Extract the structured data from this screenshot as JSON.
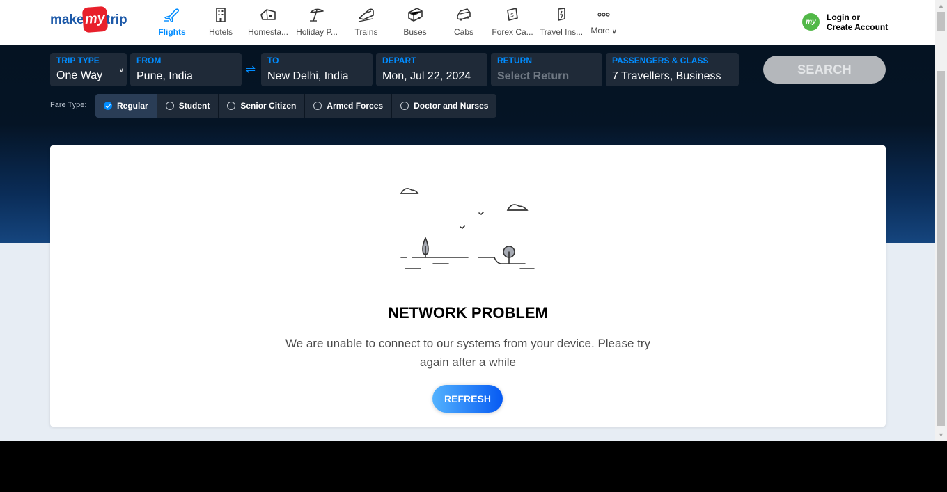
{
  "brand": {
    "make": "make",
    "my": "my",
    "trip": "trip"
  },
  "nav": [
    {
      "label": "Flights",
      "icon": "flight-icon",
      "active": true
    },
    {
      "label": "Hotels",
      "icon": "hotel-icon"
    },
    {
      "label": "Homesta...",
      "icon": "homestay-icon"
    },
    {
      "label": "Holiday P...",
      "icon": "holiday-package-icon"
    },
    {
      "label": "Trains",
      "icon": "train-icon"
    },
    {
      "label": "Buses",
      "icon": "bus-icon"
    },
    {
      "label": "Cabs",
      "icon": "cab-icon"
    },
    {
      "label": "Forex Ca...",
      "icon": "forex-card-icon"
    },
    {
      "label": "Travel Ins...",
      "icon": "travel-insurance-icon"
    },
    {
      "label": "More",
      "icon": "more-dots-icon"
    }
  ],
  "user": {
    "line1": "Login or",
    "line2": "Create Account",
    "avatar": "my"
  },
  "search": {
    "trip_type": {
      "label": "TRIP TYPE",
      "value": "One Way"
    },
    "from": {
      "label": "FROM",
      "value": "Pune, India"
    },
    "to": {
      "label": "TO",
      "value": "New Delhi, India"
    },
    "depart": {
      "label": "DEPART",
      "value": "Mon, Jul 22, 2024"
    },
    "return": {
      "label": "RETURN",
      "placeholder": "Select Return"
    },
    "passengers": {
      "label": "PASSENGERS & CLASS",
      "value": "7 Travellers, Business"
    },
    "button": "SEARCH"
  },
  "fare": {
    "label": "Fare Type:",
    "options": [
      {
        "label": "Regular",
        "selected": true
      },
      {
        "label": "Student"
      },
      {
        "label": "Senior Citizen"
      },
      {
        "label": "Armed Forces"
      },
      {
        "label": "Doctor and Nurses"
      }
    ]
  },
  "error": {
    "title": "NETWORK PROBLEM",
    "message": "We are unable to connect to our systems from your device. Please try again after a while",
    "button": "REFRESH"
  },
  "colors": {
    "accent": "#008cff",
    "brand_red": "#e8202b",
    "hero_dark": "#051322"
  }
}
